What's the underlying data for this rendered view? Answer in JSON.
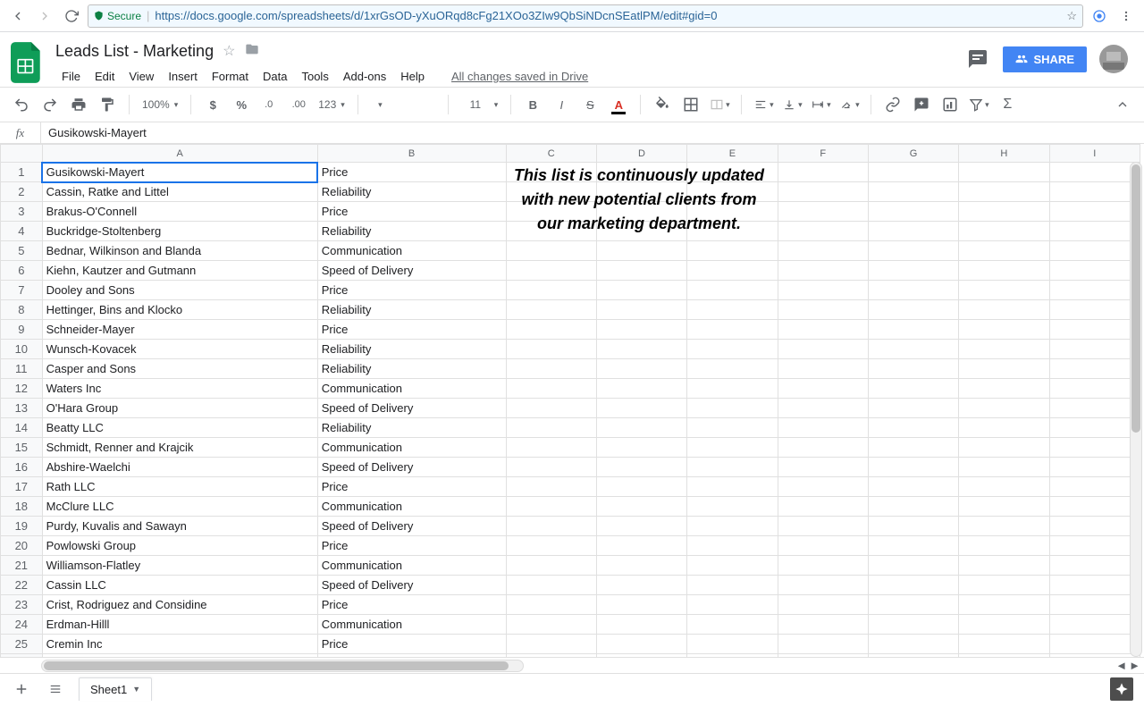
{
  "browser": {
    "secure_label": "Secure",
    "url": "https://docs.google.com/spreadsheets/d/1xrGsOD-yXuORqd8cFg21XOo3ZIw9QbSiNDcnSEatlPM/edit#gid=0"
  },
  "doc": {
    "title": "Leads List - Marketing",
    "save_status": "All changes saved in Drive"
  },
  "menu": {
    "file": "File",
    "edit": "Edit",
    "view": "View",
    "insert": "Insert",
    "format": "Format",
    "data": "Data",
    "tools": "Tools",
    "addons": "Add-ons",
    "help": "Help"
  },
  "toolbar": {
    "zoom": "100%",
    "font_size": "11",
    "num_fmt": "123",
    "currency": "$",
    "percent": "%"
  },
  "share": {
    "label": "SHARE"
  },
  "formula": {
    "fx": "fx",
    "value": "Gusikowski-Mayert"
  },
  "columns": [
    "A",
    "B",
    "C",
    "D",
    "E",
    "F",
    "G",
    "H",
    "I"
  ],
  "overlay_note": "This list is continuously updated with new potential clients from our marketing department.",
  "rows": [
    {
      "n": "1",
      "a": "Gusikowski-Mayert",
      "b": "Price"
    },
    {
      "n": "2",
      "a": "Cassin, Ratke and Littel",
      "b": "Reliability"
    },
    {
      "n": "3",
      "a": "Brakus-O'Connell",
      "b": "Price"
    },
    {
      "n": "4",
      "a": "Buckridge-Stoltenberg",
      "b": "Reliability"
    },
    {
      "n": "5",
      "a": "Bednar, Wilkinson and Blanda",
      "b": "Communication"
    },
    {
      "n": "6",
      "a": "Kiehn, Kautzer and Gutmann",
      "b": "Speed of Delivery"
    },
    {
      "n": "7",
      "a": "Dooley and Sons",
      "b": "Price"
    },
    {
      "n": "8",
      "a": "Hettinger, Bins and Klocko",
      "b": "Reliability"
    },
    {
      "n": "9",
      "a": "Schneider-Mayer",
      "b": "Price"
    },
    {
      "n": "10",
      "a": "Wunsch-Kovacek",
      "b": "Reliability"
    },
    {
      "n": "11",
      "a": "Casper and Sons",
      "b": "Reliability"
    },
    {
      "n": "12",
      "a": "Waters Inc",
      "b": "Communication"
    },
    {
      "n": "13",
      "a": "O'Hara Group",
      "b": "Speed of Delivery"
    },
    {
      "n": "14",
      "a": "Beatty LLC",
      "b": "Reliability"
    },
    {
      "n": "15",
      "a": "Schmidt, Renner and Krajcik",
      "b": "Communication"
    },
    {
      "n": "16",
      "a": "Abshire-Waelchi",
      "b": "Speed of Delivery"
    },
    {
      "n": "17",
      "a": "Rath LLC",
      "b": "Price"
    },
    {
      "n": "18",
      "a": "McClure LLC",
      "b": "Communication"
    },
    {
      "n": "19",
      "a": "Purdy, Kuvalis and Sawayn",
      "b": "Speed of Delivery"
    },
    {
      "n": "20",
      "a": "Powlowski Group",
      "b": "Price"
    },
    {
      "n": "21",
      "a": "Williamson-Flatley",
      "b": "Communication"
    },
    {
      "n": "22",
      "a": "Cassin LLC",
      "b": "Speed of Delivery"
    },
    {
      "n": "23",
      "a": "Crist, Rodriguez and Considine",
      "b": "Price"
    },
    {
      "n": "24",
      "a": "Erdman-Hilll",
      "b": "Communication"
    },
    {
      "n": "25",
      "a": "Cremin Inc",
      "b": "Price"
    },
    {
      "n": "26",
      "a": "",
      "b": ""
    }
  ],
  "sheet_tab": {
    "name": "Sheet1"
  }
}
